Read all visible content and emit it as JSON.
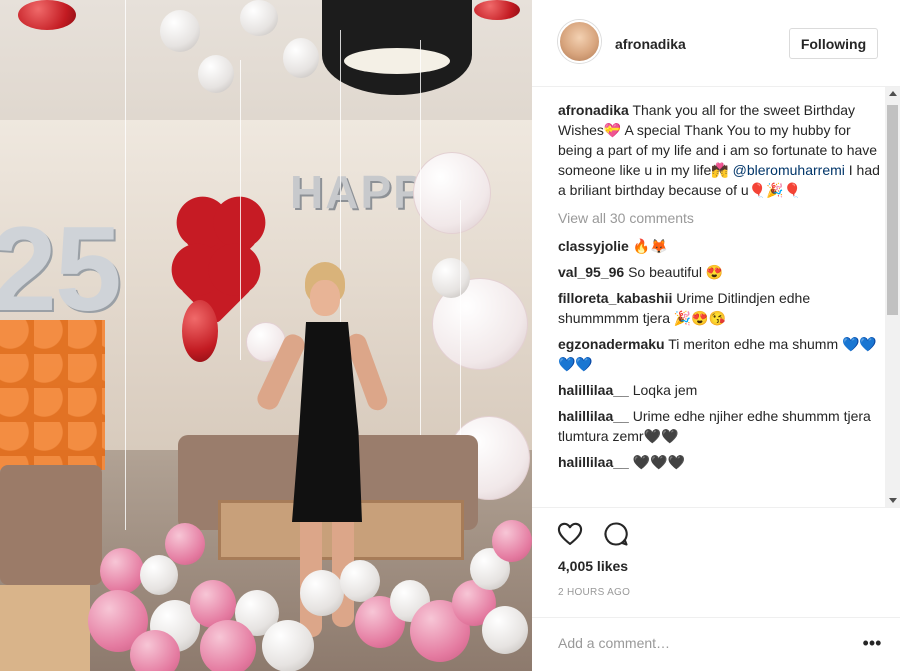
{
  "post": {
    "username": "afronadika",
    "follow_label": "Following",
    "caption": {
      "username": "afronadika",
      "text_before": "Thank you all for the sweet Birthday Wishes💝 A special Thank You to my hubby for being a part of my life and i am so fortunate to have someone like u in my life💏",
      "mention": "@bleromuharremi",
      "text_after": "I had a briliant birthday because of u🎈🎉🎈"
    },
    "view_all_label": "View all 30 comments",
    "comments": [
      {
        "user": "classyjolie",
        "text": "🔥🦊"
      },
      {
        "user": "val_95_96",
        "text": "So beautiful 😍"
      },
      {
        "user": "filloreta_kabashii",
        "text": "Urime Ditlindjen edhe shummmmm tjera 🎉😍😘"
      },
      {
        "user": "egzonadermaku",
        "text": "Ti meriton edhe ma shumm 💙💙💙💙"
      },
      {
        "user": "halillilaa__",
        "text": "Loqka jem"
      },
      {
        "user": "halillilaa__",
        "text": "Urime edhe njiher edhe shummm tjera tlumtura zemr🖤🖤"
      },
      {
        "user": "halillilaa__",
        "text": "🖤🖤🖤"
      }
    ],
    "likes_label": "4,005 likes",
    "time_label": "2 HOURS AGO",
    "add_comment_placeholder": "Add a comment…",
    "more_icon": "•••"
  },
  "photo": {
    "number_left": "2",
    "number_right": "5",
    "letters": "HAPPY"
  }
}
